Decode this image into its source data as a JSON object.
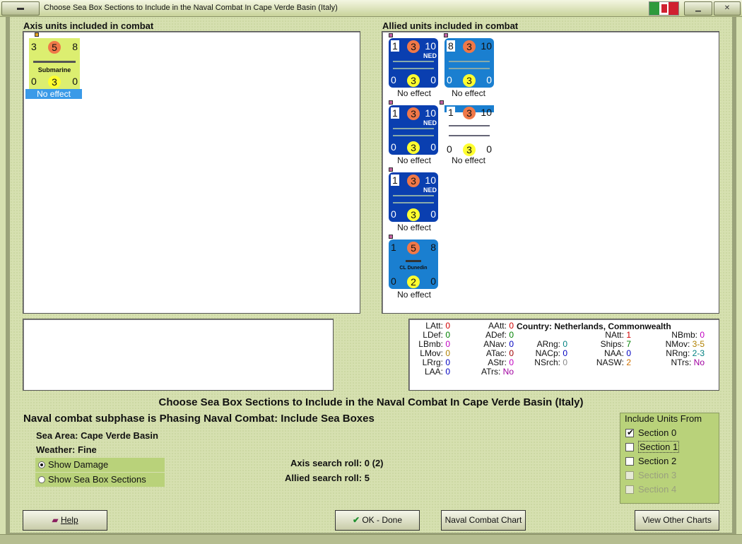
{
  "window": {
    "title": "Choose Sea Box Sections to Include in the Naval Combat In Cape Verde Basin (Italy)"
  },
  "axis_panel": {
    "label": "Axis units included in combat",
    "units": [
      {
        "att": "3",
        "def": "5",
        "mov": "8",
        "name": "Submarine",
        "b1": "0",
        "b2": "3",
        "b3": "0",
        "effect": "No effect"
      }
    ]
  },
  "allied_panel": {
    "label": "Allied units included in combat",
    "units": [
      {
        "tl": "1",
        "c": "3",
        "tr": "10",
        "nat": "NED",
        "b1": "0",
        "b2": "3",
        "b3": "0",
        "effect": "No effect"
      },
      {
        "tl": "8",
        "c": "3",
        "tr": "10",
        "nat": "",
        "b1": "0",
        "b2": "3",
        "b3": "0",
        "effect": "No effect"
      },
      {
        "tl": "1",
        "c": "3",
        "tr": "10",
        "nat": "NED",
        "b1": "0",
        "b2": "3",
        "b3": "0",
        "effect": "No effect"
      },
      {
        "tl": "1",
        "c": "3",
        "tr": "10",
        "nat": "",
        "b1": "0",
        "b2": "3",
        "b3": "0",
        "effect": "No effect"
      },
      {
        "tl": "1",
        "c": "3",
        "tr": "10",
        "nat": "NED",
        "b1": "0",
        "b2": "3",
        "b3": "0",
        "effect": "No effect"
      },
      {
        "tl": "1",
        "c": "5",
        "tr": "8",
        "name": "CL Dunedin",
        "b1": "0",
        "b2": "2",
        "b3": "0",
        "effect": "No effect"
      }
    ]
  },
  "stats": {
    "country_label": "Country:",
    "country_value": "Netherlands, Commonwealth",
    "col1": [
      {
        "k": "LAtt:",
        "v": "0",
        "c": "#d00000"
      },
      {
        "k": "LDef:",
        "v": "0",
        "c": "#008000"
      },
      {
        "k": "LBmb:",
        "v": "0",
        "c": "#c000c0"
      },
      {
        "k": "LMov:",
        "v": "0",
        "c": "#b08000"
      },
      {
        "k": "LRrg:",
        "v": "0",
        "c": "#0000c0"
      },
      {
        "k": "LAA:",
        "v": "0",
        "c": "#0000c0"
      }
    ],
    "col2": [
      {
        "k": "AAtt:",
        "v": "0",
        "c": "#d00000"
      },
      {
        "k": "ADef:",
        "v": "0",
        "c": "#008000"
      },
      {
        "k": "ANav:",
        "v": "0",
        "c": "#0000c0"
      },
      {
        "k": "ATac:",
        "v": "0",
        "c": "#a00000"
      },
      {
        "k": "AStr:",
        "v": "0",
        "c": "#c000c0"
      },
      {
        "k": "ATrs:",
        "v": "No",
        "c": "#a000a0"
      }
    ],
    "col3": [
      {
        "k": "ARng:",
        "v": "0",
        "c": "#008080"
      },
      {
        "k": "NACp:",
        "v": "0",
        "c": "#0000c0"
      },
      {
        "k": "NSrch:",
        "v": "0",
        "c": "#888888"
      }
    ],
    "col4": [
      {
        "k": "NAtt:",
        "v": "1",
        "c": "#d00000"
      },
      {
        "k": "Ships:",
        "v": "7",
        "c": "#008000"
      },
      {
        "k": "NAA:",
        "v": "0",
        "c": "#0000c0"
      },
      {
        "k": "NASW:",
        "v": "2",
        "c": "#d07000"
      }
    ],
    "col5": [
      {
        "k": "NBmb:",
        "v": "0",
        "c": "#c000c0"
      },
      {
        "k": "NMov:",
        "v": "3-5",
        "c": "#b08000"
      },
      {
        "k": "NRng:",
        "v": "2-3",
        "c": "#008080"
      },
      {
        "k": "NTrs:",
        "v": "No",
        "c": "#a000a0"
      }
    ]
  },
  "main": {
    "heading": "Choose Sea Box Sections to Include in the Naval Combat In Cape Verde Basin (Italy)",
    "subphase": "Naval combat subphase is Phasing Naval Combat: Include Sea Boxes",
    "sea_area_label": "Sea Area:",
    "sea_area_value": "Cape Verde Basin",
    "weather_label": "Weather:",
    "weather_value": "Fine",
    "show_damage": "Show Damage",
    "show_sections": "Show Sea Box Sections",
    "axis_roll": "Axis search roll: 0 (2)",
    "allied_roll": "Allied search roll: 5"
  },
  "include_units": {
    "title": "Include Units From",
    "sections": [
      {
        "label": "Section 0",
        "checked": true,
        "enabled": true
      },
      {
        "label": "Section 1",
        "checked": false,
        "enabled": true
      },
      {
        "label": "Section 2",
        "checked": false,
        "enabled": true
      },
      {
        "label": "Section 3",
        "checked": false,
        "enabled": false
      },
      {
        "label": "Section 4",
        "checked": false,
        "enabled": false
      }
    ]
  },
  "buttons": {
    "help": "Help",
    "ok": "OK - Done",
    "chart": "Naval Combat Chart",
    "other": "View Other Charts"
  },
  "colors": {
    "background": "#d6e0b0",
    "counter_blue": "#1a7fd0",
    "counter_ned": "#0a3fb0",
    "sub_yellow": "#dcee70",
    "selected_blue": "#3a9ae8"
  }
}
